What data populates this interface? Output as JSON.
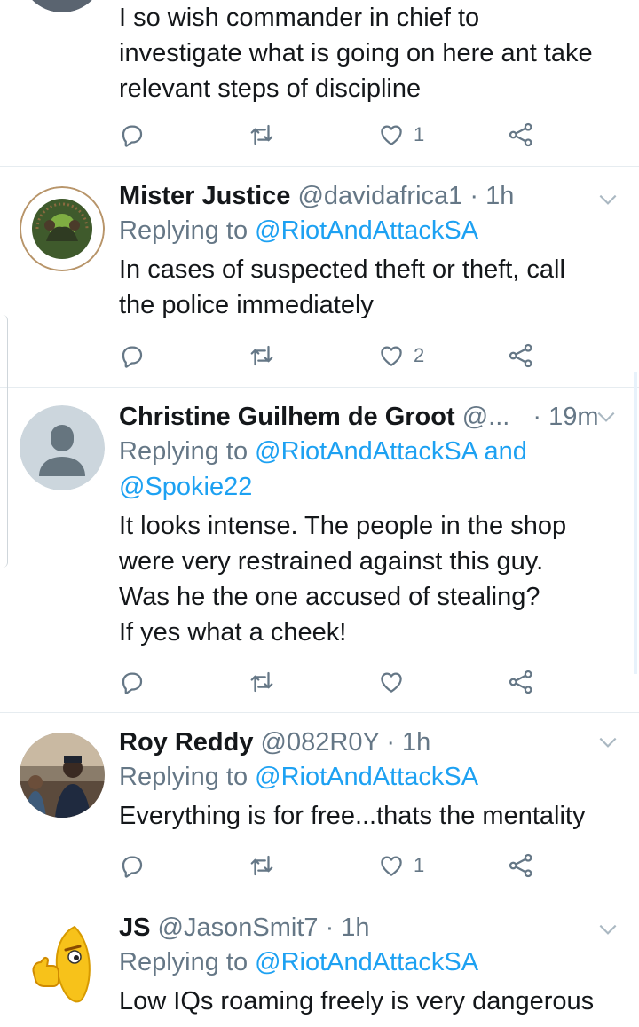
{
  "tweets": [
    {
      "text_lines": [
        "I so wish commander in chief to",
        "investigate what is going on here ant take",
        "relevant steps of discipline"
      ],
      "like_count": "1"
    },
    {
      "name": "Mister Justice",
      "handle": "@davidafrica1",
      "time": "· 1h",
      "reply_prefix": "Replying to",
      "mentions": [
        "@RiotAndAttackSA"
      ],
      "text_lines": [
        "In cases of suspected theft or theft, call",
        "the police immediately"
      ],
      "like_count": "2"
    },
    {
      "name": "Christine Guilhem de Groot",
      "handle": "@...",
      "time": "· 19m",
      "reply_prefix": "Replying to",
      "mentions": [
        "@RiotAndAttackSA",
        "@Spokie22"
      ],
      "and": "and",
      "text_lines": [
        "It looks intense. The people in the shop",
        "were very restrained against this guy.",
        "Was he the one accused of stealing?",
        "If yes what a cheek!"
      ],
      "like_count": ""
    },
    {
      "name": "Roy Reddy",
      "handle": "@082R0Y",
      "time": "· 1h",
      "reply_prefix": "Replying to",
      "mentions": [
        "@RiotAndAttackSA"
      ],
      "text_lines": [
        "Everything is for free...thats the mentality"
      ],
      "like_count": "1"
    },
    {
      "name": "JS",
      "handle": "@JasonSmit7",
      "time": "· 1h",
      "reply_prefix": "Replying to",
      "mentions": [
        "@RiotAndAttackSA"
      ],
      "text_lines": [
        "Low IQs roaming freely is very dangerous"
      ]
    }
  ],
  "colors": {
    "link": "#1da1f2",
    "secondary": "#657786",
    "text": "#14171a",
    "divider": "#e6ecf0"
  },
  "icons": [
    "reply-icon",
    "retweet-icon",
    "like-icon",
    "share-icon",
    "caret-down-icon"
  ]
}
